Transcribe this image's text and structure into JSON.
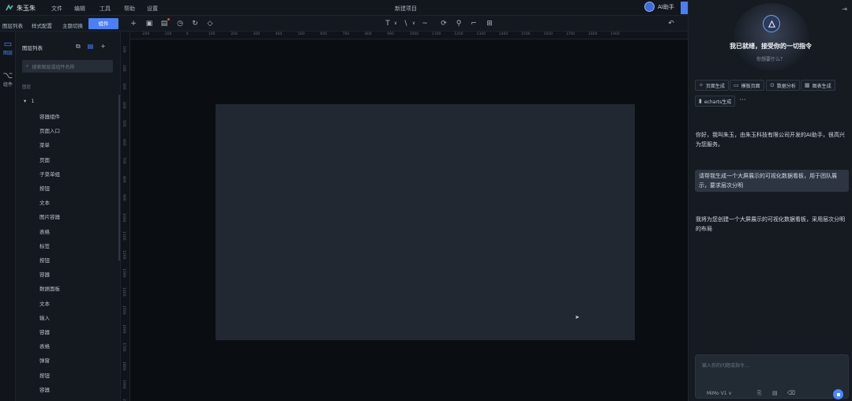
{
  "app": {
    "name": "朱玉朱",
    "doc_title": "新建项目"
  },
  "menu": [
    "文件",
    "编辑",
    "工具",
    "帮助",
    "设置"
  ],
  "ai_button": {
    "label": "AI助手"
  },
  "subtabs": [
    "图层列表",
    "样式配置",
    "主题切换",
    "组件"
  ],
  "toolbar": {
    "text_tool": "T",
    "line_tool": "\\",
    "curve_tool": "~"
  },
  "rail": [
    {
      "icon": "layers-icon",
      "label": "图层"
    },
    {
      "icon": "component-icon",
      "label": "组件"
    }
  ],
  "layers": {
    "title": "图层列表",
    "search_placeholder": "搜索图层或组件名称",
    "group_label": "图层",
    "root_label": "1",
    "items": [
      "容器组件",
      "页面入口",
      "菜单",
      "页面",
      "子菜单组",
      "按钮",
      "文本",
      "图片容器",
      "表格",
      "标签",
      "按钮",
      "容器",
      "数据面板",
      "文本",
      "输入",
      "容器",
      "表格",
      "弹窗",
      "按钮",
      "容器"
    ]
  },
  "rulers": {
    "top": [
      "-200",
      "-100",
      "0",
      "100",
      "200",
      "300",
      "400",
      "500",
      "600",
      "700",
      "800",
      "900",
      "1000",
      "1100",
      "1200",
      "1300",
      "1400",
      "1500",
      "1600",
      "1700",
      "1800",
      "1900"
    ],
    "left": [
      "100",
      "200",
      "300",
      "400",
      "500",
      "600",
      "700",
      "800",
      "900",
      "1000",
      "1100",
      "1200",
      "1300",
      "1400",
      "1500",
      "1600",
      "1700",
      "1800",
      "1900",
      "2000"
    ]
  },
  "ai_panel": {
    "heading": "我已就绪，接受你的一切指令",
    "subheading": "你想要什么？",
    "chips": [
      "页面生成",
      "模板页面",
      "数据分析",
      "图表生成",
      "echarts生成"
    ],
    "more": "···",
    "messages": [
      {
        "role": "assistant",
        "text": "你好，我叫朱玉，由朱玉科技有限公司开发的AI助手，很高兴为您服务。"
      },
      {
        "role": "user",
        "text": "请帮我生成一个大屏展示的可视化数据看板，用于团队展示，要求层次分明"
      },
      {
        "role": "assistant",
        "text": "我将为您创建一个大屏展示的可视化数据看板，采用层次分明的布局"
      }
    ],
    "input_placeholder": "输入你的问题或指令...",
    "model": "MiMo V1 ∨"
  },
  "colors": {
    "accent": "#4a7ff5",
    "canvas": "#212832",
    "background": "#0a0d12"
  }
}
